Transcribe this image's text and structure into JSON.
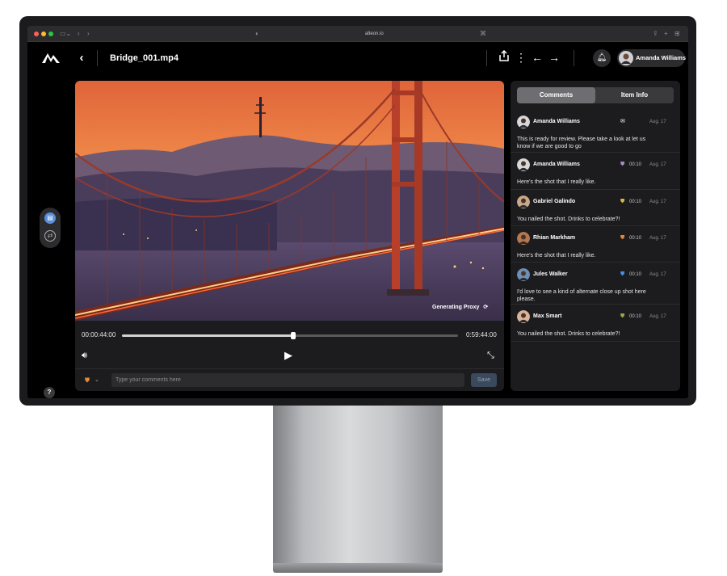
{
  "browser": {
    "url": "alteon.io"
  },
  "header": {
    "back_label": "‹",
    "file_title": "Bridge_001.mp4",
    "user_name": "Amanda Williams",
    "icons": [
      "share-icon",
      "more-icon",
      "prev-arrow-icon",
      "next-arrow-icon",
      "bell-icon"
    ]
  },
  "player": {
    "proxy_label": "Generating Proxy",
    "current_time": "00:00:44:00",
    "total_time": "0:59:44:00",
    "progress": 0.51,
    "comment_placeholder": "Type your comments here",
    "save_label": "Save"
  },
  "panel": {
    "tabs": [
      {
        "label": "Comments",
        "active": true
      },
      {
        "label": "Item Info",
        "active": false
      }
    ],
    "comments": [
      {
        "name": "Amanda Williams",
        "timecode": "",
        "flag_color": "#ffffff",
        "date": "Aug. 17",
        "text": "This is ready for review. Please take a look at let us know if we are good to go"
      },
      {
        "name": "Amanda Williams",
        "timecode": "00:10",
        "flag_color": "#a78bc9",
        "date": "Aug. 17",
        "text": "Here's the shot that I really like."
      },
      {
        "name": "Gabriel Galindo",
        "timecode": "00:10",
        "flag_color": "#d9b84a",
        "date": "Aug. 17",
        "text": "You nailed the shot. Drinks to celebrate?!"
      },
      {
        "name": "Rhian Markham",
        "timecode": "00:10",
        "flag_color": "#e08a3c",
        "date": "Aug. 17",
        "text": "Here's the shot that I really like."
      },
      {
        "name": "Jules Walker",
        "timecode": "00:10",
        "flag_color": "#4a8fe0",
        "date": "Aug. 17",
        "text": "I'd love to see a kind of alternate close up shot here please."
      },
      {
        "name": "Max Smart",
        "timecode": "00:10",
        "flag_color": "#9aa84a",
        "date": "Aug. 17",
        "text": "You nailed the shot. Drinks to celebrate?!"
      }
    ]
  },
  "colors": {
    "accent": "#5b8fd9",
    "panel_bg": "#1c1c1e",
    "screen_bg": "#000000"
  }
}
